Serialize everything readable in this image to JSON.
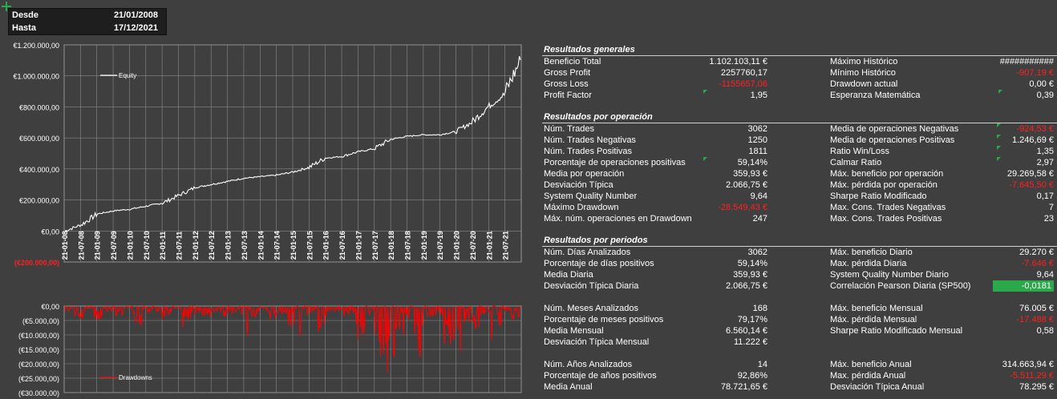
{
  "dates": {
    "from_label": "Desde",
    "from_value": "21/01/2008",
    "to_label": "Hasta",
    "to_value": "17/12/2021"
  },
  "equity_chart": {
    "legend": "Equity",
    "y_ticks": [
      "€1.200.000,00",
      "€1.000.000,00",
      "€800.000,00",
      "€600.000,00",
      "€400.000,00",
      "€200.000,00",
      "€0,00",
      "(€200.000,00)"
    ],
    "x_ticks": [
      "21-01-08",
      "21-07-08",
      "21-01-09",
      "21-07-09",
      "21-01-10",
      "21-07-10",
      "21-01-11",
      "21-07-11",
      "21-01-12",
      "21-07-12",
      "21-01-13",
      "21-07-13",
      "21-01-14",
      "21-07-14",
      "21-01-15",
      "21-07-15",
      "21-01-16",
      "21-07-16",
      "21-01-17",
      "21-07-17",
      "21-01-18",
      "21-07-18",
      "21-01-19",
      "21-07-19",
      "21-01-20",
      "21-07-20",
      "21-01-21",
      "21-07-21"
    ],
    "color": "#ffffff"
  },
  "drawdown_chart": {
    "legend": "Drawdowns",
    "y_ticks": [
      "€0,00",
      "(€5.000,00)",
      "(€10.000,00)",
      "(€15.000,00)",
      "(€20.000,00)",
      "(€25.000,00)",
      "(€30.000,00)"
    ],
    "color": "#ff0000"
  },
  "chart_data": [
    {
      "type": "line",
      "legend": "Equity",
      "ylim": [
        -200000,
        1200000
      ],
      "x": [
        "21-01-08",
        "21-07-08",
        "21-01-09",
        "21-07-09",
        "21-01-10",
        "21-07-10",
        "21-01-11",
        "21-07-11",
        "21-01-12",
        "21-07-12",
        "21-01-13",
        "21-07-13",
        "21-01-14",
        "21-07-14",
        "21-01-15",
        "21-07-15",
        "21-01-16",
        "21-07-16",
        "21-01-17",
        "21-07-17",
        "21-01-18",
        "21-07-18",
        "21-01-19",
        "21-07-19",
        "21-01-20",
        "21-07-20",
        "21-01-21",
        "21-07-21",
        "17-12-21"
      ],
      "values": [
        0,
        40000,
        110000,
        130000,
        140000,
        160000,
        180000,
        230000,
        280000,
        300000,
        320000,
        340000,
        350000,
        360000,
        380000,
        410000,
        470000,
        480000,
        510000,
        530000,
        590000,
        610000,
        620000,
        620000,
        640000,
        700000,
        800000,
        880000,
        1102103
      ],
      "y_ticks": [
        1200000,
        1000000,
        800000,
        600000,
        400000,
        200000,
        0,
        -200000
      ]
    },
    {
      "type": "line",
      "legend": "Drawdowns",
      "ylim": [
        -30000,
        0
      ],
      "values": [
        -2000,
        -5000,
        -1000,
        -6000,
        -2000,
        -4000,
        -1000,
        -7000,
        -3000,
        -2000,
        -5000,
        -2000,
        -8000,
        -3000,
        -4000,
        -2000,
        -6000,
        -3000,
        -11000,
        -4000,
        -2000,
        -5000,
        -3000,
        -8000,
        -12000,
        -4000,
        -9000,
        -2000,
        -5000,
        -3000,
        -14000,
        -6000,
        -18000,
        -27000,
        -12000,
        -8000,
        -20000,
        -10000,
        -5000,
        -14000,
        -18000,
        -6000,
        -9000,
        -3000,
        -12000,
        -2000,
        -5000,
        -2000
      ],
      "y_ticks": [
        0,
        -5000,
        -10000,
        -15000,
        -20000,
        -25000,
        -30000
      ]
    }
  ],
  "general": {
    "title": "Resultados generales",
    "left": [
      {
        "label": "Beneficio Total",
        "value": "1.102.103,11 €",
        "neg": false
      },
      {
        "label": "Gross Profit",
        "value": "2257760,17",
        "neg": false
      },
      {
        "label": "Gross Loss",
        "value": "-1155657,06",
        "neg": true
      },
      {
        "label": "Profit Factor",
        "value": "1,95",
        "neg": false
      }
    ],
    "right": [
      {
        "label": "Máximo Histórico",
        "value": "###########",
        "neg": false
      },
      {
        "label": "Mínimo Histórico",
        "value": "-907,19 €",
        "neg": true
      },
      {
        "label": "Drawdown actual",
        "value": "0,00 €",
        "neg": false
      },
      {
        "label": "Esperanza Matemática",
        "value": "0,39",
        "neg": false
      }
    ]
  },
  "per_trade": {
    "title": "Resultados por operación",
    "left": [
      {
        "label": "Núm. Trades",
        "value": "3062",
        "neg": false
      },
      {
        "label": "Núm. Trades Negativas",
        "value": "1250",
        "neg": false
      },
      {
        "label": "Núm. Trades Positivas",
        "value": "1811",
        "neg": false
      },
      {
        "label": "Porcentaje de operaciones positivas",
        "value": "59,14%",
        "neg": false
      },
      {
        "label": "Media por operación",
        "value": "359,93 €",
        "neg": false
      },
      {
        "label": "Desviación Típica",
        "value": "2.066,75 €",
        "neg": false
      },
      {
        "label": "System Quality Number",
        "value": "9,64",
        "neg": false
      },
      {
        "label": "Máximo Drawdown",
        "value": "-28.549,43 €",
        "neg": true
      },
      {
        "label": "Máx. núm. operaciones en Drawdown",
        "value": "247",
        "neg": false
      }
    ],
    "right": [
      {
        "label": "Media de operaciones Negativas",
        "value": "-924,53 €",
        "neg": true
      },
      {
        "label": "Media de operaciones Positivas",
        "value": "1.246,69 €",
        "neg": false
      },
      {
        "label": "Ratio Win/Loss",
        "value": "1,35",
        "neg": false
      },
      {
        "label": "Calmar Ratio",
        "value": "2,97",
        "neg": false
      },
      {
        "label": "Máx. beneficio por operación",
        "value": "29.269,58 €",
        "neg": false
      },
      {
        "label": "Máx. pérdida por operación",
        "value": "-7.645,50 €",
        "neg": true
      },
      {
        "label": "Sharpe Ratio Modificado",
        "value": "0,17",
        "neg": false
      },
      {
        "label": "Max. Cons. Trades Negativas",
        "value": "7",
        "neg": false
      },
      {
        "label": "Max. Cons. Trades Positivas",
        "value": "23",
        "neg": false
      }
    ]
  },
  "periods": {
    "title": "Resultados por periodos",
    "left": [
      {
        "label": "Núm. Días Analizados",
        "value": "3062",
        "neg": false
      },
      {
        "label": "Porcentaje de días positivos",
        "value": "59,14%",
        "neg": false
      },
      {
        "label": "Media Diaria",
        "value": "359,93 €",
        "neg": false
      },
      {
        "label": "Desviación Típica Diaria",
        "value": "2.066,75 €",
        "neg": false
      },
      {
        "label": "",
        "value": "",
        "neg": false
      },
      {
        "label": "Núm. Meses Analizados",
        "value": "168",
        "neg": false
      },
      {
        "label": "Porcentaje de meses positivos",
        "value": "79,17%",
        "neg": false
      },
      {
        "label": "Media Mensual",
        "value": "6.560,14 €",
        "neg": false
      },
      {
        "label": "Desviación Típica Mensual",
        "value": "11.222 €",
        "neg": false
      },
      {
        "label": "",
        "value": "",
        "neg": false
      },
      {
        "label": "Núm. Años Analizados",
        "value": "14",
        "neg": false
      },
      {
        "label": "Porcentaje de años positivos",
        "value": "92,86%",
        "neg": false
      },
      {
        "label": "Media Anual",
        "value": "78.721,65 €",
        "neg": false
      }
    ],
    "right": [
      {
        "label": "Máx. beneficio Diario",
        "value": "29.270 €",
        "neg": false
      },
      {
        "label": "Max. pérdida Diaria",
        "value": "-7.646 €",
        "neg": true
      },
      {
        "label": "System Quality Number Diario",
        "value": "9,64",
        "neg": false
      },
      {
        "label": "Correlación Pearson Diaria (SP500)",
        "value": "-0,0181",
        "neg": false,
        "highlight": true
      },
      {
        "label": "",
        "value": "",
        "neg": false
      },
      {
        "label": "Máx. beneficio Mensual",
        "value": "76.005 €",
        "neg": false
      },
      {
        "label": "Máx. pérdida Mensual",
        "value": "-17.488 €",
        "neg": true
      },
      {
        "label": "Sharpe Ratio Modificado Mensual",
        "value": "0,58",
        "neg": false
      },
      {
        "label": "",
        "value": "",
        "neg": false
      },
      {
        "label": "",
        "value": "",
        "neg": false
      },
      {
        "label": "Máx. beneficio Anual",
        "value": "314.663,94 €",
        "neg": false
      },
      {
        "label": "Max. pérdida Anual",
        "value": "-5.511,29 €",
        "neg": true
      },
      {
        "label": "Desviación Típica Anual",
        "value": "78.295 €",
        "neg": false
      }
    ]
  },
  "colors": {
    "background": "#3f3f3f",
    "negative": "#ff2020",
    "highlight": "#2aa84a"
  }
}
